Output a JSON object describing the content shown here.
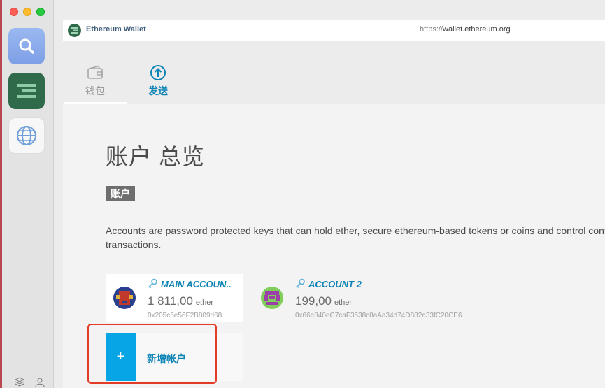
{
  "app": {
    "name": "Ethereum Wallet",
    "url_protocol": "https://",
    "url_host": "wallet.ethereum.org"
  },
  "dock": {
    "items": [
      {
        "name": "search",
        "icon": "magnifier-icon"
      },
      {
        "name": "wallet",
        "icon": "ethereum-wallet-icon"
      },
      {
        "name": "browser",
        "icon": "globe-icon"
      }
    ],
    "footer_icons": [
      "layers-icon",
      "user-icon"
    ]
  },
  "tabs": [
    {
      "label": "钱包",
      "icon": "wallet-icon",
      "active": false
    },
    {
      "label": "发送",
      "icon": "arrow-up-circle-icon",
      "active": true
    }
  ],
  "page": {
    "title": "账户 总览",
    "section_label": "账户",
    "description": "Accounts are password protected keys that can hold ether, secure ethereum-based tokens or coins and control contracts transactions."
  },
  "accounts": [
    {
      "name": "MAIN ACCOUN..",
      "balance": "1 811,00",
      "unit": "ether",
      "address": "0x205c6e56F2B809d68..."
    },
    {
      "name": "ACCOUNT 2",
      "balance": "199,00",
      "unit": "ether",
      "address": "0x66e840eC7caF3538c8aAa34d74D882a33fC20CE6"
    }
  ],
  "add_account": {
    "plus": "+",
    "label": "新增帐户"
  },
  "colors": {
    "accent": "#0b83b5",
    "add_button": "#07a5e3",
    "highlight": "#e33b26",
    "wallet_green": "#2f6b4b"
  }
}
